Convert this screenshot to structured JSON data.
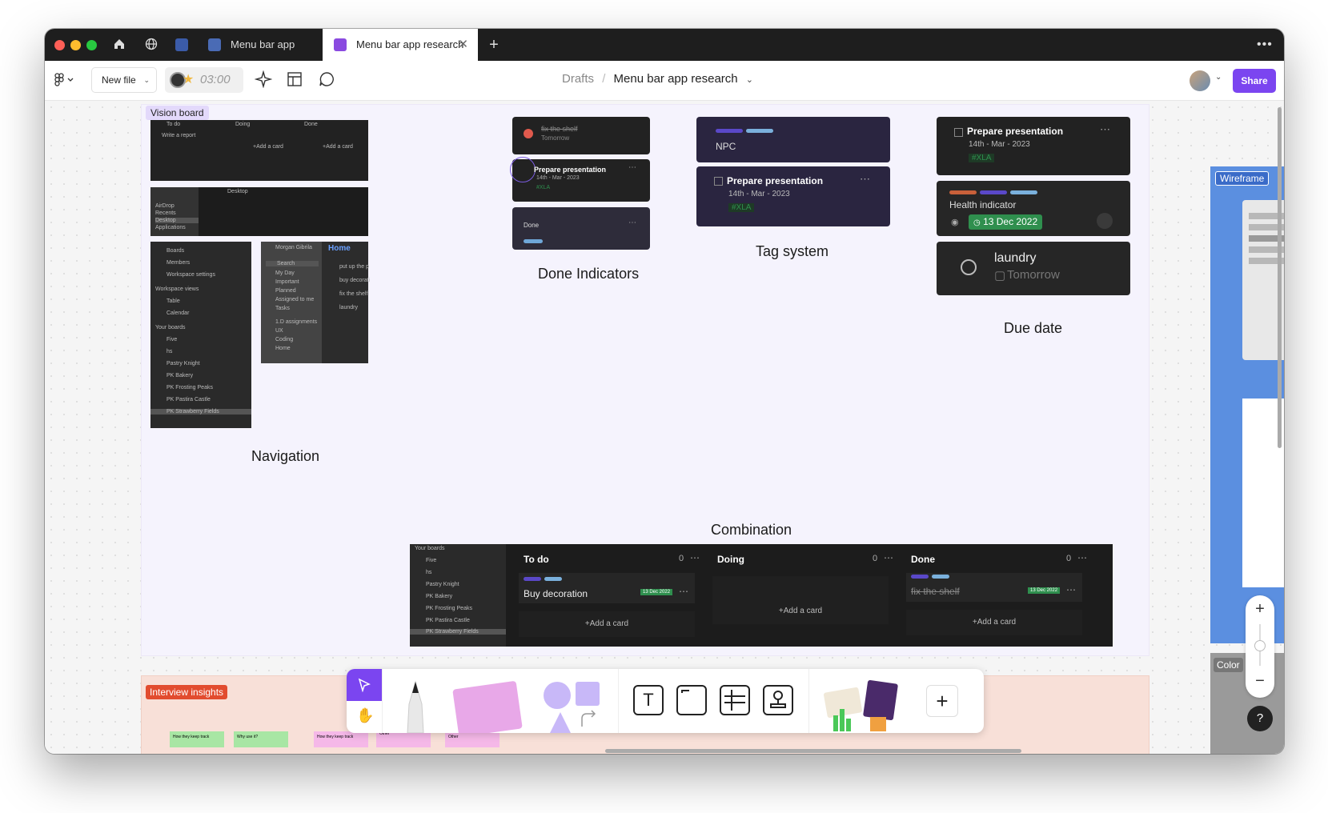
{
  "tabs": [
    {
      "label": "Menu bar app"
    },
    {
      "label": "Menu bar app research"
    }
  ],
  "toolbar": {
    "new_file": "New file",
    "timer": "03:00",
    "breadcrumb_parent": "Drafts",
    "breadcrumb_sep": "/",
    "file_title": "Menu bar app research",
    "share": "Share"
  },
  "sections": {
    "vision_board": "Vision board",
    "interview_insights": "Interview insights",
    "wireframe": "Wireframe",
    "color": "Color"
  },
  "labels": {
    "navigation": "Navigation",
    "done_indicators": "Done Indicators",
    "tag_system": "Tag system",
    "due_date": "Due date",
    "combination": "Combination"
  },
  "done_cards": {
    "fix": "fix the shelf",
    "tomorrow": "Tomorrow",
    "prepare": "Prepare presentation",
    "date": "14th - Mar - 2023",
    "xla": "#XLA",
    "done": "Done"
  },
  "tag_cards": {
    "npc": "NPC",
    "prepare": "Prepare presentation",
    "date": "14th - Mar - 2023",
    "xla": "#XLA"
  },
  "due_cards": {
    "prepare": "Prepare presentation",
    "date": "14th - Mar - 2023",
    "xla": "#XLA",
    "health": "Health indicator",
    "health_date": "13 Dec 2022",
    "laundry": "laundry",
    "tomorrow": "Tomorrow"
  },
  "nav_shots": {
    "sidebar_items": [
      "Boards",
      "Members",
      "Workspace settings"
    ],
    "workspace_views": "Workspace views",
    "views": [
      "Table",
      "Calendar"
    ],
    "your_boards": "Your boards",
    "boards": [
      "Five",
      "hs",
      "Pastry Knight",
      "PK Bakery",
      "PK Frosting Peaks",
      "PK Pastira Castle",
      "PK Strawberry Fields"
    ],
    "todo_user": "Morgan Gibrila",
    "todo_search": "Search",
    "todo_items": [
      "My Day",
      "Important",
      "Planned",
      "Assigned to me",
      "Tasks",
      "1.D assignments",
      "UX",
      "Coding",
      "Home"
    ],
    "home_title": "Home",
    "home_tasks": [
      "put up the p",
      "buy decorati",
      "fix the shelf",
      "laundry"
    ],
    "desktop": "Desktop",
    "finder_items": [
      "AirDrop",
      "Recents",
      "Desktop",
      "Applications",
      "Downloads"
    ],
    "kanban_cols": [
      "To do",
      "Doing",
      "Done"
    ],
    "write_report": "Write a report",
    "add_card": "+Add a card"
  },
  "combination": {
    "your_boards": "Your boards",
    "boards": [
      "Five",
      "hs",
      "Pastry Knight",
      "PK Bakery",
      "PK Frosting Peaks",
      "PK Pastira Castle",
      "PK Strawberry Fields"
    ],
    "columns": [
      {
        "title": "To do",
        "count": "0",
        "card": "Buy decoration",
        "date": "13 Dec 2022",
        "add": "+Add a card"
      },
      {
        "title": "Doing",
        "count": "0",
        "card": "",
        "date": "",
        "add": "+Add a card"
      },
      {
        "title": "Done",
        "count": "0",
        "card": "fix the shelf",
        "date": "13 Dec 2022",
        "add": "+Add a card"
      }
    ]
  },
  "sticky_notes": [
    "How they keep track",
    "Why use it?",
    "How they keep track",
    "Other",
    "Other"
  ],
  "colors": {
    "accent": "#7b45f0",
    "tag_green": "#2f8f4e",
    "interview_red": "#e24c2f",
    "wireframe_blue": "#5b8fe0"
  }
}
